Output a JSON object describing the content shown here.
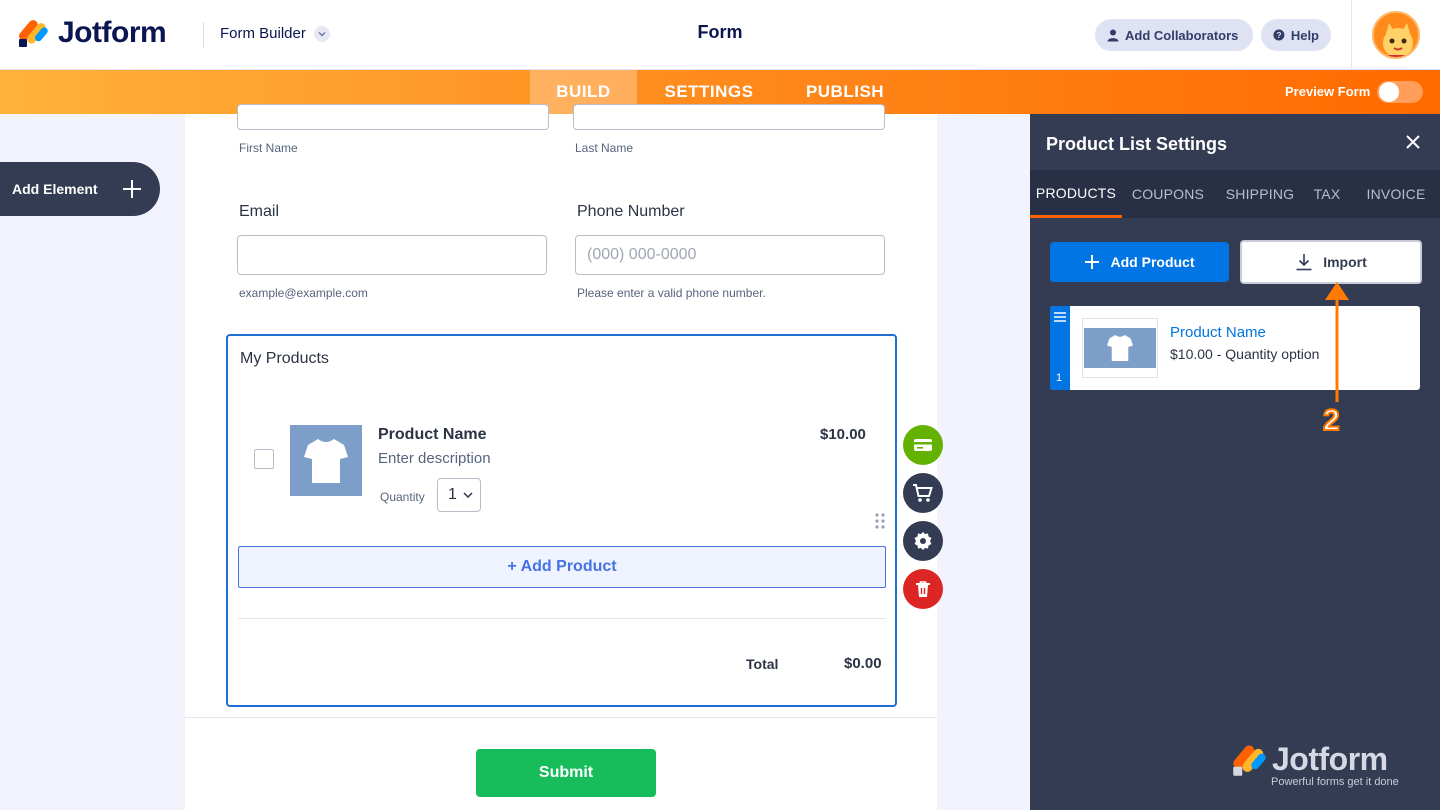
{
  "header": {
    "brand": "Jotform",
    "builder_label": "Form Builder",
    "title": "Form",
    "collaborators_label": "Add Collaborators",
    "help_label": "Help"
  },
  "nav": {
    "tabs": [
      "BUILD",
      "SETTINGS",
      "PUBLISH"
    ],
    "active": "BUILD",
    "preview_label": "Preview Form",
    "preview_on": false
  },
  "left": {
    "add_element_label": "Add Element"
  },
  "form": {
    "name_sublabels": [
      "First Name",
      "Last Name"
    ],
    "email": {
      "label": "Email",
      "value": "",
      "sublabel": "example@example.com"
    },
    "phone": {
      "label": "Phone Number",
      "placeholder": "(000) 000-0000",
      "sublabel": "Please enter a valid phone number."
    },
    "products": {
      "label": "My Products",
      "item": {
        "name": "Product Name",
        "description": "Enter description",
        "price": "$10.00",
        "quantity_label": "Quantity",
        "quantity": "1"
      },
      "add_button": "+ Add Product",
      "total_label": "Total",
      "total_value": "$0.00"
    },
    "submit_label": "Submit"
  },
  "panel": {
    "title": "Product List Settings",
    "tabs": [
      "PRODUCTS",
      "COUPONS",
      "SHIPPING",
      "TAX",
      "INVOICE"
    ],
    "active_tab": "PRODUCTS",
    "add_product_label": "Add Product",
    "import_label": "Import",
    "product_card": {
      "index": "1",
      "name": "Product Name",
      "description": "$10.00 - Quantity option"
    },
    "annotation_step": "2"
  },
  "watermark": {
    "brand": "Jotform",
    "tagline": "Powerful forms get it done"
  },
  "colors": {
    "accent_orange": "#ff6100",
    "primary_blue": "#0075e3",
    "submit_green": "#18bd5b",
    "panel_bg": "#343c54",
    "delete_red": "#dc2626",
    "payment_green": "#64b200"
  }
}
